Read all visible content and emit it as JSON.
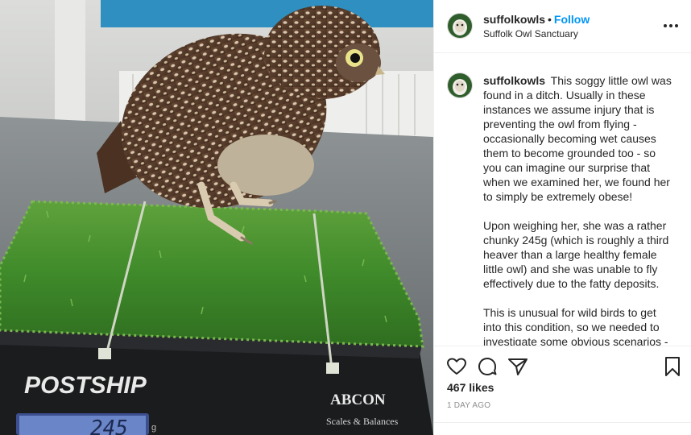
{
  "photo": {
    "alt": "Little owl standing on artificial grass on a weighing scale",
    "scale_brand": "POSTSHIP",
    "scale_maker": "ABCON",
    "scale_maker_sub": "Scales & Balances",
    "display_reading": "245",
    "display_unit": "g"
  },
  "header": {
    "username": "suffolkowls",
    "separator": "•",
    "follow_label": "Follow",
    "location": "Suffolk Owl Sanctuary",
    "more_icon": "more-options-icon"
  },
  "caption": {
    "username": "suffolkowls",
    "paragraphs": [
      "This soggy little owl was found in a ditch. Usually in these instances we assume injury that is preventing the owl from flying - occasionally becoming wet causes them to become grounded too - so you can imagine our surprise that when we examined her, we found her to simply be extremely obese!",
      "Upon weighing her, she was a rather chunky 245g (which is roughly a third heaver than a large healthy female little owl) and she was unable to fly effectively due to the fatty deposits.",
      "This is unusual for wild birds to get into this condition, so we needed to investigate some obvious scenarios - the first being that she was possibly"
    ]
  },
  "actions": {
    "like_icon": "heart-icon",
    "comment_icon": "comment-icon",
    "share_icon": "share-icon",
    "save_icon": "bookmark-icon"
  },
  "likes": "467 likes",
  "timestamp": "1 DAY AGO",
  "colors": {
    "follow": "#0095f6",
    "text": "#262626",
    "muted": "#8e8e8e",
    "border": "#efefef",
    "grass": "#3f8a2a"
  }
}
